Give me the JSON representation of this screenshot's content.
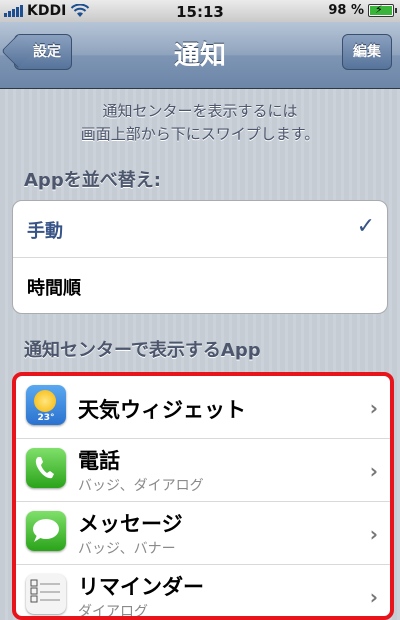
{
  "status_bar": {
    "carrier": "KDDI",
    "time": "15:13",
    "battery": "98 %",
    "battery_level": 0.98
  },
  "nav": {
    "back_label": "設定",
    "title": "通知",
    "edit_label": "編集"
  },
  "info": {
    "line1": "通知センターを表示するには",
    "line2": "画面上部から下にスワイプします。"
  },
  "sort": {
    "header": "Appを並べ替え:",
    "options": [
      {
        "label": "手動",
        "selected": true
      },
      {
        "label": "時間順",
        "selected": false
      }
    ],
    "check_glyph": "✓"
  },
  "apps": {
    "header": "通知センターで表示するApp",
    "items": [
      {
        "title": "天気ウィジェット",
        "subtitle": "",
        "icon": "weather-icon",
        "icon_label": "23°"
      },
      {
        "title": "電話",
        "subtitle": "バッジ、ダイアログ",
        "icon": "phone-icon"
      },
      {
        "title": "メッセージ",
        "subtitle": "バッジ、バナー",
        "icon": "messages-icon"
      },
      {
        "title": "リマインダー",
        "subtitle": "ダイアログ",
        "icon": "reminders-icon"
      }
    ],
    "chevron_glyph": "›"
  },
  "colors": {
    "accent": "#385487",
    "highlight_border": "#e8141c",
    "nav_top": "#b7c5d7",
    "nav_bottom": "#6d86a8"
  }
}
